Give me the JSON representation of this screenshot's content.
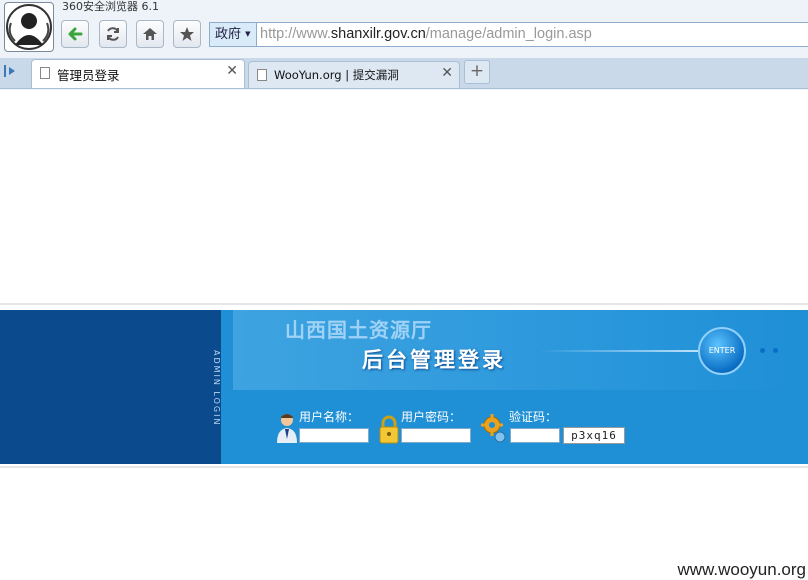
{
  "browser": {
    "app_title": "360安全浏览器 6.1",
    "address_badge": "政府",
    "url_prefix": "http://www.",
    "url_domain": "shanxilr.gov.cn",
    "url_path": "/manage/admin_login.asp"
  },
  "tabs": [
    {
      "label": "管理员登录",
      "active": true
    },
    {
      "label": "WooYun.org | 提交漏洞",
      "active": false
    }
  ],
  "icons": {
    "back": "back-arrow-icon",
    "refresh": "refresh-icon",
    "home": "home-icon",
    "favorite": "star-icon",
    "sidebar": "sidebar-toggle-icon",
    "close": "close-icon",
    "new_tab": "plus-icon",
    "user": "user-icon",
    "password": "lock-icon",
    "captcha": "gear-icon"
  },
  "page": {
    "side_text": "ADMIN LOGIN",
    "org_title": "山西国土资源厅",
    "login_title": "后台管理登录",
    "enter_label": "ENTER",
    "username_label": "用户名称：",
    "password_label": "用户密码：",
    "captcha_label": "验证码：",
    "captcha_code": "p3xq16",
    "username_value": "",
    "password_value": "",
    "captcha_value": ""
  },
  "watermark": "www.wooyun.org",
  "colors": {
    "banner": "#1f8fd6",
    "banner_dark": "#0c4a8e",
    "back_green": "#3aa63a"
  }
}
